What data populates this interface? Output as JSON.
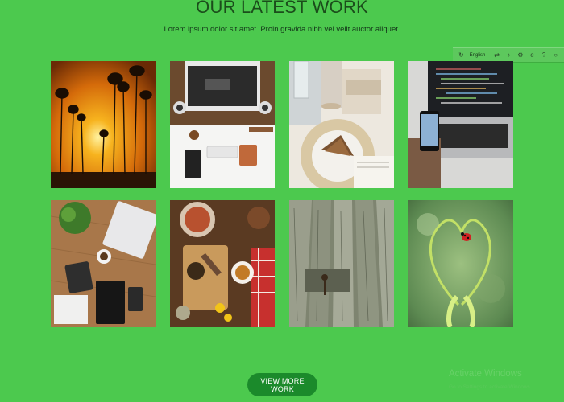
{
  "section": {
    "title": "OUR LATEST WORK",
    "subtitle": "Lorem ipsum dolor sit amet. Proin gravida nibh vel velit auctor aliquet."
  },
  "language_bar": {
    "language": "English",
    "icons": [
      "refresh-icon",
      "translate-icon",
      "speaker-icon",
      "settings-icon",
      "info-icon",
      "ie-icon",
      "help-icon",
      "close-icon"
    ]
  },
  "portfolio": {
    "tiles": [
      {
        "subject": "sunset-forest"
      },
      {
        "subject": "desk-workspace"
      },
      {
        "subject": "coffee-cake"
      },
      {
        "subject": "laptop-phone-code"
      },
      {
        "subject": "wooden-desk-keyboard"
      },
      {
        "subject": "food-spread"
      },
      {
        "subject": "wooden-planks"
      },
      {
        "subject": "heart-plant-ladybug"
      }
    ]
  },
  "cta": {
    "view_more_label": "VIEW MORE WORK"
  },
  "watermark": {
    "title": "Activate Windows",
    "subtitle": "Go to Settings to activate Windows."
  },
  "colors": {
    "background": "#4cc94e",
    "button": "#1b8a2b",
    "title": "#1b4d1b"
  }
}
